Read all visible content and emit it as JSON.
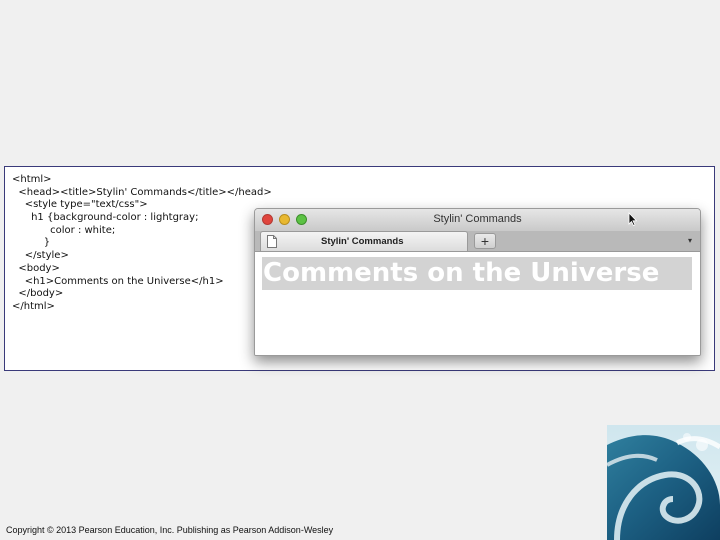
{
  "code_lines": [
    "<html>",
    "  <head><title>Stylin' Commands</title></head>",
    "    <style type=\"text/css\">",
    "      h1 {background-color : lightgray;",
    "            color : white;",
    "          }",
    "    </style>",
    "  <body>",
    "    <h1>Comments on the Universe</h1>",
    "  </body>",
    "</html>"
  ],
  "browser": {
    "window_title": "Stylin' Commands",
    "tab_label": "Stylin' Commands",
    "new_tab_label": "+",
    "tab_menu_label": "▾",
    "heading": "Comments on the Universe"
  },
  "colors": {
    "heading_background": "#d3d3d3",
    "heading_text": "#ffffff",
    "close": "#e0453d",
    "minimize": "#e8b830",
    "zoom": "#5cc244"
  },
  "footer": {
    "copyright": "Copyright © 2013 Pearson Education, Inc. Publishing as Pearson Addison-Wesley"
  }
}
